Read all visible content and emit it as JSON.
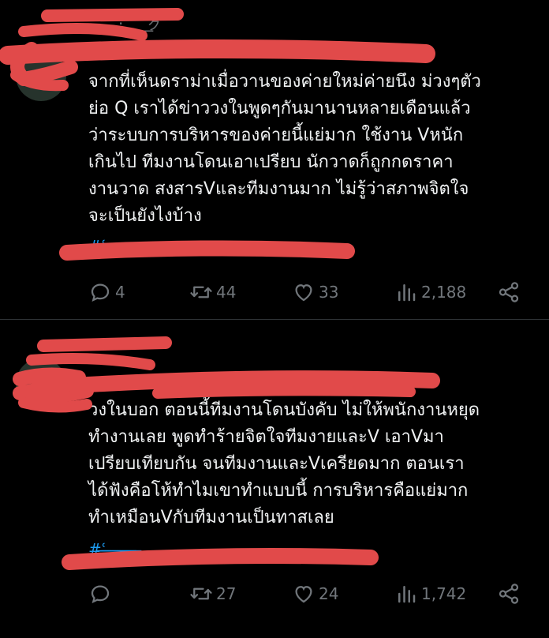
{
  "tweets": [
    {
      "text_lines": [
        "จากที่เห็นดราม่าเมื่อวานของค่ายใหม่ค่ายนึง ม่วงๆตัว",
        "ย่อ Q เราได้ข่าววงในพูดๆกันมานานหลายเดือนแล้ว",
        "ว่าระบบการบริหารของค่ายนี้แย่มาก ใช้งาน Vหนัก",
        "เกินไป ทีมงานโดนเอาเปรียบ นักวาดก็ถูกกดราคา",
        "งานวาด สงสารVและทีมงานมาก ไม่รู้ว่าสภาพจิตใจ",
        "จะเป็นยังไงบ้าง"
      ],
      "replies": "4",
      "retweets": "44",
      "likes": "33",
      "views": "2,188"
    },
    {
      "text_lines": [
        "วงในบอก ตอนนี้ทีมงานโดนบังคับ ไม่ให้พนักงานหยุด",
        "ทำงานเลย พูดทำร้ายจิตใจทีมงายและV เอาVมา",
        "เปรียบเทียบกัน จนทีมงานและVเครียดมาก ตอนเรา",
        "ได้ฟังคือโห้ทำไมเขาทำแบบนี้ การบริหารคือแย่มาก",
        "ทำเหมือนVกับทีมงานเป็นทาสเลย"
      ],
      "replies": "",
      "retweets": "27",
      "likes": "24",
      "views": "1,742"
    }
  ],
  "icons": {
    "reply": "reply-icon",
    "retweet": "retweet-icon",
    "like": "like-icon",
    "views": "views-icon",
    "share": "share-icon"
  },
  "colors": {
    "background": "#000000",
    "text": "#eff1f2",
    "muted": "#71767b",
    "link": "#1d9bf0",
    "redaction": "#e14a4a"
  }
}
